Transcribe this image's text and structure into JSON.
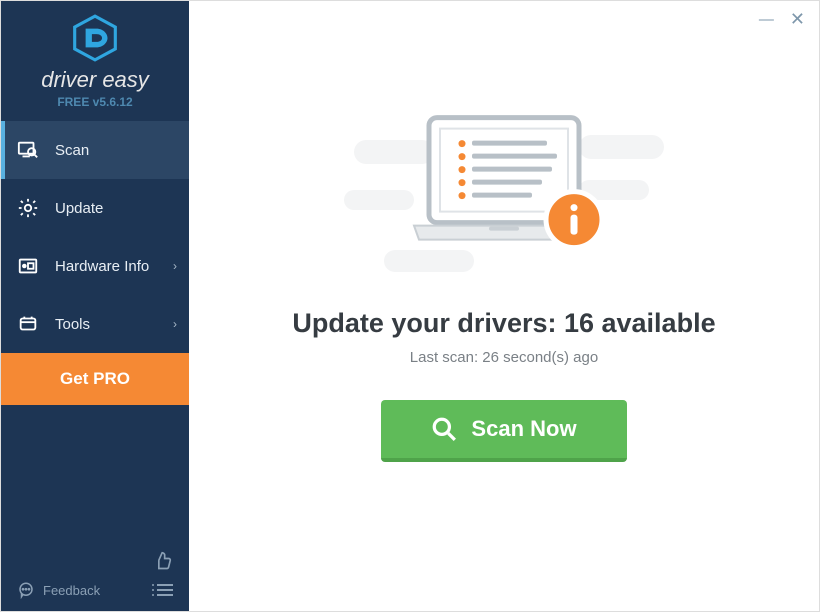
{
  "brand": "driver easy",
  "version": "FREE v5.6.12",
  "nav": {
    "scan": "Scan",
    "update": "Update",
    "hardware": "Hardware Info",
    "tools": "Tools"
  },
  "get_pro": "Get PRO",
  "feedback": "Feedback",
  "main": {
    "headline": "Update your drivers: 16 available",
    "subtext": "Last scan: 26 second(s) ago",
    "scan_button": "Scan Now"
  }
}
